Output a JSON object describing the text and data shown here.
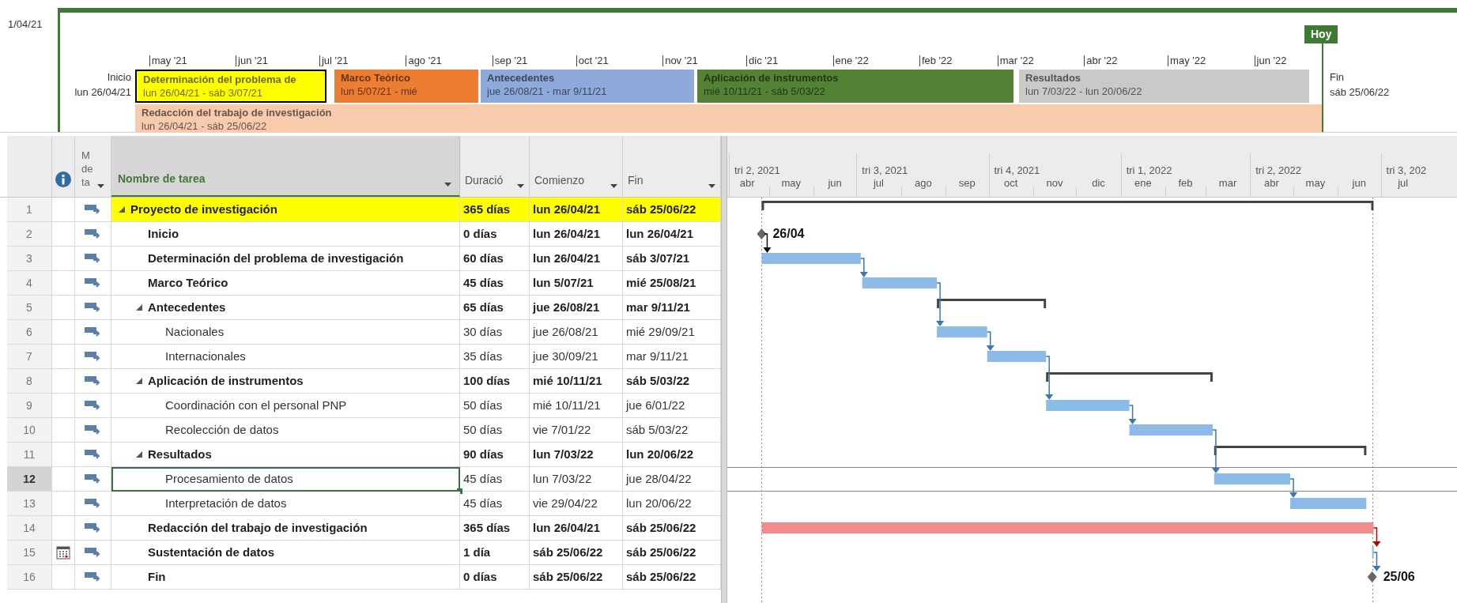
{
  "timeline": {
    "start_date": "1/04/21",
    "start_label": "Inicio",
    "start_date_label": "lun 26/04/21",
    "end_label": "Fin",
    "end_date_label": "sáb 25/06/22",
    "today": "Hoy",
    "months": [
      "may '21",
      "jun '21",
      "jul '21",
      "ago '21",
      "sep '21",
      "oct '21",
      "nov '21",
      "dic '21",
      "ene '22",
      "feb '22",
      "mar '22",
      "abr '22",
      "may '22",
      "jun '22"
    ],
    "bars": [
      {
        "name": "Determinación del problema de",
        "dates": "lun 26/04/21 - sáb 3/07/21",
        "color": "#ffff00",
        "selected": true
      },
      {
        "name": "Marco Teórico",
        "dates": "lun 5/07/21 - mié",
        "color": "#ed7d31",
        "selected": false
      },
      {
        "name": "Antecedentes",
        "dates": "jue 26/08/21 - mar 9/11/21",
        "color": "#8eaadb",
        "selected": false
      },
      {
        "name": "Aplicación de instrumentos",
        "dates": "mié 10/11/21 - sáb 5/03/22",
        "color": "#548235",
        "selected": false
      },
      {
        "name": "Resultados",
        "dates": "lun 7/03/22 - lun 20/06/22",
        "color": "#c9c9c9",
        "selected": false
      }
    ],
    "lower_bars": [
      {
        "name": "Redacción del trabajo de investigación",
        "dates": "lun 26/04/21 - sáb 25/06/22",
        "color": "#f8cbad",
        "selected": false
      }
    ]
  },
  "table": {
    "mode_header": "M de ta",
    "columns": [
      "Nombre de tarea",
      "Duració",
      "Comienzo",
      "Fin"
    ]
  },
  "gantt": {
    "quarters": [
      "tri 2, 2021",
      "tri 3, 2021",
      "tri 4, 2021",
      "tri 1, 2022",
      "tri 2, 2022",
      "tri 3, 202"
    ],
    "months": [
      "abr",
      "may",
      "jun",
      "jul",
      "ago",
      "sep",
      "oct",
      "nov",
      "dic",
      "ene",
      "feb",
      "mar",
      "abr",
      "may",
      "jun",
      "jul"
    ]
  },
  "rows": [
    {
      "id": "1",
      "name": "Proyecto de investigación",
      "kind": "summary",
      "bold": true,
      "highlight": true,
      "expanded": true,
      "selected": false,
      "calendar": false,
      "duration": "365 días",
      "start": "lun 26/04/21",
      "finish": "sáb 25/06/22",
      "children": [
        {
          "id": "2",
          "name": "Inicio",
          "kind": "milestone",
          "bar_label": "26/04",
          "bold": true,
          "highlight": false,
          "selected": false,
          "calendar": false,
          "duration": "0 días",
          "start": "lun 26/04/21",
          "finish": "lun 26/04/21"
        },
        {
          "id": "3",
          "name": "Determinación del problema de investigación",
          "kind": "task",
          "bold": true,
          "highlight": false,
          "selected": false,
          "calendar": false,
          "duration": "60 días",
          "start": "lun 26/04/21",
          "finish": "sáb 3/07/21"
        },
        {
          "id": "4",
          "name": "Marco Teórico",
          "kind": "task",
          "bold": true,
          "highlight": false,
          "selected": false,
          "calendar": false,
          "duration": "45 días",
          "start": "lun 5/07/21",
          "finish": "mié 25/08/21"
        },
        {
          "id": "5",
          "name": "Antecedentes",
          "kind": "summary",
          "bold": true,
          "highlight": false,
          "expanded": true,
          "selected": false,
          "calendar": false,
          "duration": "65 días",
          "start": "jue 26/08/21",
          "finish": "mar 9/11/21",
          "children": [
            {
              "id": "6",
              "name": "Nacionales",
              "kind": "task",
              "bold": false,
              "highlight": false,
              "selected": false,
              "calendar": false,
              "duration": "30 días",
              "start": "jue 26/08/21",
              "finish": "mié 29/09/21"
            },
            {
              "id": "7",
              "name": "Internacionales",
              "kind": "task",
              "bold": false,
              "highlight": false,
              "selected": false,
              "calendar": false,
              "duration": "35 días",
              "start": "jue 30/09/21",
              "finish": "mar 9/11/21"
            }
          ]
        },
        {
          "id": "8",
          "name": "Aplicación de instrumentos",
          "kind": "summary",
          "bold": true,
          "highlight": false,
          "expanded": true,
          "selected": false,
          "calendar": false,
          "duration": "100 días",
          "start": "mié 10/11/21",
          "finish": "sáb 5/03/22",
          "children": [
            {
              "id": "9",
              "name": "Coordinación con el personal PNP",
              "kind": "task",
              "bold": false,
              "highlight": false,
              "selected": false,
              "calendar": false,
              "duration": "50 días",
              "start": "mié 10/11/21",
              "finish": "jue 6/01/22"
            },
            {
              "id": "10",
              "name": "Recolección de datos",
              "kind": "task",
              "bold": false,
              "highlight": false,
              "selected": false,
              "calendar": false,
              "duration": "50 días",
              "start": "vie 7/01/22",
              "finish": "sáb 5/03/22"
            }
          ]
        },
        {
          "id": "11",
          "name": "Resultados",
          "kind": "summary",
          "bold": true,
          "highlight": false,
          "expanded": true,
          "selected": false,
          "calendar": false,
          "duration": "90 días",
          "start": "lun 7/03/22",
          "finish": "lun 20/06/22",
          "children": [
            {
              "id": "12",
              "name": "Procesamiento de datos",
              "kind": "task",
              "bold": false,
              "highlight": false,
              "selected": true,
              "calendar": false,
              "duration": "45 días",
              "start": "lun 7/03/22",
              "finish": "jue 28/04/22"
            },
            {
              "id": "13",
              "name": "Interpretación de datos",
              "kind": "task",
              "bold": false,
              "highlight": false,
              "selected": false,
              "calendar": false,
              "duration": "45 días",
              "start": "vie 29/04/22",
              "finish": "lun 20/06/22"
            }
          ]
        },
        {
          "id": "14",
          "name": "Redacción del trabajo de investigación",
          "kind": "critical",
          "bold": true,
          "highlight": false,
          "selected": false,
          "calendar": false,
          "duration": "365 días",
          "start": "lun 26/04/21",
          "finish": "sáb 25/06/22"
        },
        {
          "id": "15",
          "name": "Sustentación de datos",
          "kind": "task",
          "bold": true,
          "highlight": false,
          "selected": false,
          "calendar": true,
          "duration": "1 día",
          "start": "sáb 25/06/22",
          "finish": "sáb 25/06/22"
        },
        {
          "id": "16",
          "name": "Fin",
          "kind": "milestone",
          "bar_label": "25/06",
          "bold": true,
          "highlight": false,
          "selected": false,
          "calendar": false,
          "duration": "0 días",
          "start": "sáb 25/06/22",
          "finish": "sáb 25/06/22"
        }
      ]
    }
  ]
}
